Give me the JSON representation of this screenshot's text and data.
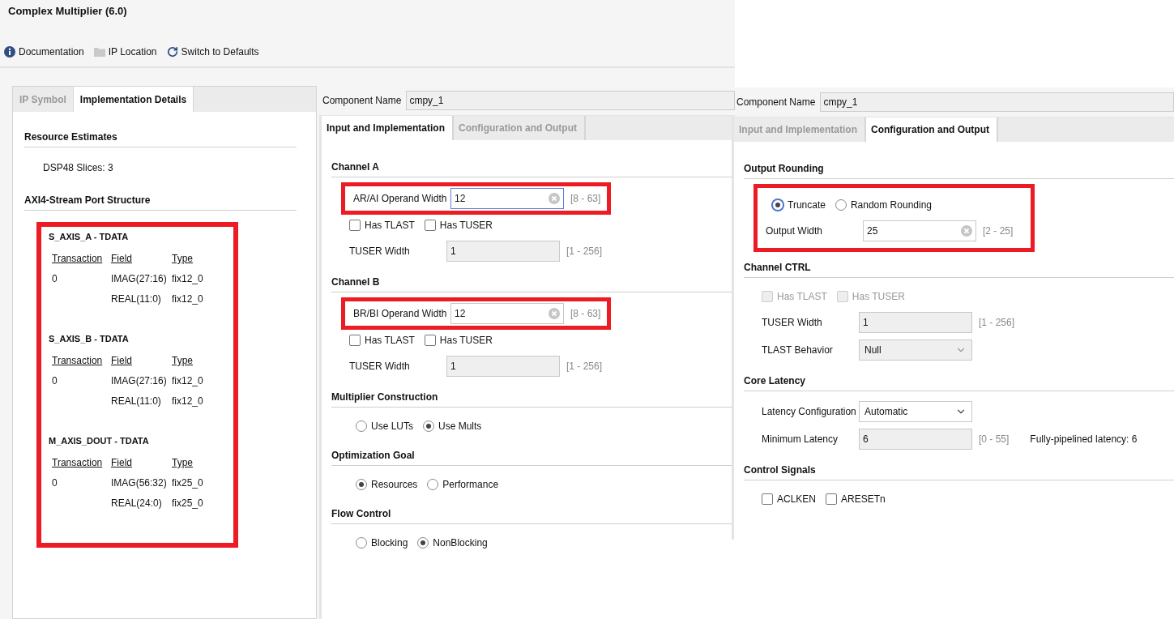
{
  "window": {
    "title": "Complex Multiplier (6.0)"
  },
  "toolbar": [
    {
      "kind": "info",
      "label": "Documentation"
    },
    {
      "kind": "folder",
      "label": "IP Location"
    },
    {
      "kind": "refresh",
      "label": "Switch to Defaults"
    }
  ],
  "details_panel": {
    "tabs": [
      {
        "label": "IP Symbol",
        "selected": false
      },
      {
        "label": "Implementation Details",
        "selected": true
      }
    ],
    "resource_heading": "Resource Estimates",
    "resource_line": "DSP48 Slices: 3",
    "port_heading": "AXI4-Stream Port Structure",
    "highlighted": true,
    "ports": [
      {
        "title": "S_AXIS_A - TDATA",
        "columns": [
          "Transaction",
          "Field",
          "Type"
        ],
        "rows": [
          {
            "transaction": "0",
            "field": "IMAG(27:16)",
            "type": "fix12_0"
          },
          {
            "field": "REAL(11:0)",
            "type": "fix12_0"
          }
        ]
      },
      {
        "title": "S_AXIS_B - TDATA",
        "columns": [
          "Transaction",
          "Field",
          "Type"
        ],
        "rows": [
          {
            "transaction": "0",
            "field": "IMAG(27:16)",
            "type": "fix12_0"
          },
          {
            "field": "REAL(11:0)",
            "type": "fix12_0"
          }
        ]
      },
      {
        "title": "M_AXIS_DOUT - TDATA",
        "columns": [
          "Transaction",
          "Field",
          "Type"
        ],
        "rows": [
          {
            "transaction": "0",
            "field": "IMAG(56:32)",
            "type": "fix25_0"
          },
          {
            "field": "REAL(24:0)",
            "type": "fix25_0"
          }
        ]
      }
    ]
  },
  "input_page": {
    "component_name": {
      "label": "Component Name",
      "value": "cmpy_1"
    },
    "tabs": [
      {
        "label": "Input and Implementation",
        "selected": true
      },
      {
        "label": "Configuration and Output",
        "selected": false
      }
    ],
    "sections": [
      {
        "title": "Channel A",
        "items": [
          {
            "kind": "field",
            "label": "AR/AI Operand Width",
            "value": "12",
            "range": "[8 - 63]",
            "clearable": true,
            "focused": true,
            "disabled": false,
            "highlighted": true
          },
          {
            "kind": "checks",
            "highlighted": false,
            "options": [
              {
                "label": "Has TLAST",
                "checked": false,
                "disabled": false
              },
              {
                "label": "Has TUSER",
                "checked": false,
                "disabled": false
              }
            ]
          },
          {
            "kind": "field",
            "label": "TUSER Width",
            "value": "1",
            "range": "[1 - 256]",
            "clearable": false,
            "focused": false,
            "disabled": true,
            "highlighted": false
          }
        ]
      },
      {
        "title": "Channel B",
        "items": [
          {
            "kind": "field",
            "label": "BR/BI Operand Width",
            "value": "12",
            "range": "[8 - 63]",
            "clearable": true,
            "focused": false,
            "disabled": false,
            "highlighted": true
          },
          {
            "kind": "checks",
            "highlighted": false,
            "options": [
              {
                "label": "Has TLAST",
                "checked": false,
                "disabled": false
              },
              {
                "label": "Has TUSER",
                "checked": false,
                "disabled": false
              }
            ]
          },
          {
            "kind": "field",
            "label": "TUSER Width",
            "value": "1",
            "range": "[1 - 256]",
            "clearable": false,
            "focused": false,
            "disabled": true,
            "highlighted": false
          }
        ]
      },
      {
        "title": "Multiplier Construction",
        "items": [
          {
            "kind": "radios",
            "highlighted": false,
            "options": [
              {
                "label": "Use LUTs",
                "selected": false,
                "focused": false
              },
              {
                "label": "Use Mults",
                "selected": true,
                "focused": false
              }
            ]
          }
        ]
      },
      {
        "title": "Optimization Goal",
        "items": [
          {
            "kind": "radios",
            "highlighted": false,
            "options": [
              {
                "label": "Resources",
                "selected": true,
                "focused": false
              },
              {
                "label": "Performance",
                "selected": false,
                "focused": false
              }
            ]
          }
        ]
      },
      {
        "title": "Flow Control",
        "items": [
          {
            "kind": "radios",
            "highlighted": false,
            "options": [
              {
                "label": "Blocking",
                "selected": false,
                "focused": false
              },
              {
                "label": "NonBlocking",
                "selected": true,
                "focused": false
              }
            ]
          }
        ]
      }
    ]
  },
  "output_page": {
    "component_name": {
      "label": "Component Name",
      "value": "cmpy_1"
    },
    "tabs": [
      {
        "label": "Input and Implementation",
        "selected": false
      },
      {
        "label": "Configuration and Output",
        "selected": true
      }
    ],
    "sections": [
      {
        "title": "Output Rounding",
        "items": [
          {
            "kind": "radios",
            "highlighted": true,
            "options": [
              {
                "label": "Truncate",
                "selected": true,
                "focused": true
              },
              {
                "label": "Random Rounding",
                "selected": false,
                "focused": false
              }
            ]
          },
          {
            "kind": "field",
            "label": "Output Width",
            "value": "25",
            "range": "[2 - 25]",
            "clearable": true,
            "focused": false,
            "disabled": false,
            "highlighted": true
          }
        ]
      },
      {
        "title": "Channel CTRL",
        "items": [
          {
            "kind": "checks",
            "highlighted": false,
            "options": [
              {
                "label": "Has TLAST",
                "checked": false,
                "disabled": true
              },
              {
                "label": "Has TUSER",
                "checked": false,
                "disabled": true
              }
            ]
          },
          {
            "kind": "field",
            "label": "TUSER Width",
            "value": "1",
            "range": "[1 - 256]",
            "clearable": false,
            "focused": false,
            "disabled": true,
            "highlighted": false
          },
          {
            "kind": "dropdown",
            "label": "TLAST Behavior",
            "value": "Null",
            "disabled": true,
            "highlighted": false
          }
        ]
      },
      {
        "title": "Core Latency",
        "items": [
          {
            "kind": "dropdown",
            "label": "Latency Configuration",
            "value": "Automatic",
            "disabled": false,
            "highlighted": false
          },
          {
            "kind": "field",
            "label": "Minimum Latency",
            "value": "6",
            "range": "[0 - 55]",
            "note": "Fully-pipelined latency: 6",
            "clearable": false,
            "focused": false,
            "disabled": true,
            "highlighted": false
          }
        ]
      },
      {
        "title": "Control Signals",
        "items": [
          {
            "kind": "checks",
            "highlighted": false,
            "options": [
              {
                "label": "ACLKEN",
                "checked": false,
                "disabled": false
              },
              {
                "label": "ARESETn",
                "checked": false,
                "disabled": false
              }
            ]
          }
        ]
      }
    ]
  }
}
